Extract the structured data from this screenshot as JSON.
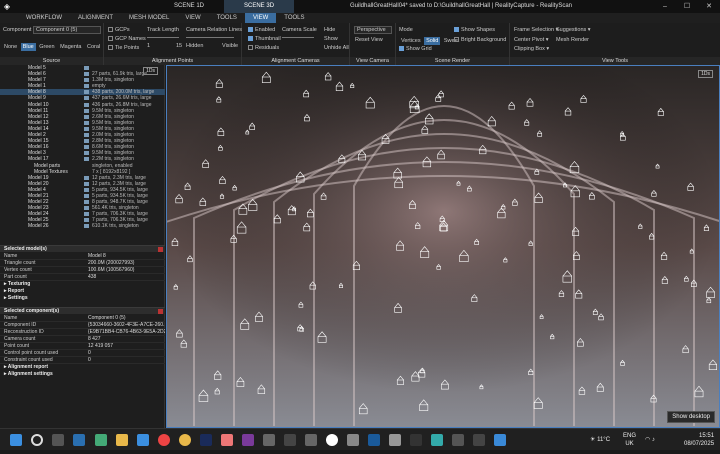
{
  "titlebar": {
    "tab_scene1d": "SCENE 1D",
    "tab_scene3d": "SCENE 3D",
    "title": "GuildhallGreatHall04* saved to D:\\GuildhallGreatHall | RealityCapture - RealityScan",
    "min": "–",
    "max": "☐",
    "close": "✕"
  },
  "menu": {
    "items": [
      "WORKFLOW",
      "ALIGNMENT",
      "MESH MODEL",
      "VIEW",
      "TOOLS",
      "VIEW",
      "TOOLS"
    ],
    "active_index": 5
  },
  "ribbon": {
    "source": {
      "title": "Source",
      "component_label": "Component",
      "component_value": "Component 0 (5)",
      "colors": [
        "None",
        "Blue",
        "Green",
        "Magenta",
        "Coral"
      ],
      "active_color": "Blue"
    },
    "alignment_points": {
      "title": "Alignment Points",
      "gcps": "GCPs",
      "gcp_names": "GCP Names",
      "tie_points": "Tie Points",
      "track_length": "Track Length",
      "track_min": "1",
      "track_max": "15",
      "relation_lines": "Camera Relation Lines",
      "hidden": "Hidden",
      "visible": "Visible"
    },
    "alignment_cameras": {
      "title": "Alignment Cameras",
      "enabled": "Enabled",
      "thumbnail": "Thumbnail",
      "residuals": "Residuals",
      "camera_scale": "Camera Scale",
      "hide": "Hide",
      "show": "Show",
      "unhide_all": "Unhide All"
    },
    "view_camera": {
      "title": "View Camera",
      "projection": "Perspective",
      "reset_view": "Reset View"
    },
    "scene_render": {
      "title": "Scene Render",
      "mode": "Mode",
      "vertices": "Vertices",
      "solid": "Solid",
      "sweet": "Sweet",
      "show_grid": "Show Grid",
      "show_shapes": "Show Shapes",
      "bright_background": "Bright Background"
    },
    "view_tools": {
      "title": "View Tools",
      "frame_selection": "Frame Selection",
      "suggestions": "Suggestions",
      "center_pivot": "Center Pivot",
      "mesh_render": "Mesh Render",
      "clipping_box": "Clipping Box"
    }
  },
  "tree": {
    "badge": "1Ds",
    "rows": [
      {
        "label": "Model 5",
        "info": "",
        "sub": false
      },
      {
        "label": "Model 6",
        "info": "27 parts, 61.9k tris, large",
        "sub": false
      },
      {
        "label": "Model 7",
        "info": "1.3M tris, singleton",
        "sub": false
      },
      {
        "label": "Model 1",
        "info": "empty",
        "sub": false
      },
      {
        "label": "Model 8",
        "info": "438 parts, 200.0M tris, large",
        "sub": false
      },
      {
        "label": "Model 9",
        "info": "437 parts, 26.6M tris, large",
        "sub": false
      },
      {
        "label": "Model 10",
        "info": "436 parts, 26.8M tris, large",
        "sub": false
      },
      {
        "label": "Model 11",
        "info": "9.5M tris, singleton",
        "sub": false
      },
      {
        "label": "Model 12",
        "info": "2.6M tris, singleton",
        "sub": false
      },
      {
        "label": "Model 13",
        "info": "9.5M tris, singleton",
        "sub": false
      },
      {
        "label": "Model 14",
        "info": "9.5M tris, singleton",
        "sub": false
      },
      {
        "label": "Model 2",
        "info": "2.0M tris, singleton",
        "sub": false
      },
      {
        "label": "Model 15",
        "info": "2.8M tris, singleton",
        "sub": false
      },
      {
        "label": "Model 16",
        "info": "8.6M tris, singleton",
        "sub": false
      },
      {
        "label": "Model 3",
        "info": "9.5M tris, singleton",
        "sub": false
      },
      {
        "label": "Model 17",
        "info": "2.2M tris, singleton",
        "sub": false
      },
      {
        "label": "Model parts",
        "info": "singleton, enabled",
        "sub": true
      },
      {
        "label": "Model Textures",
        "info": "7 x [ 8192x8192 ]",
        "sub": true
      },
      {
        "label": "Model 19",
        "info": "12 parts, 2.3M tris, large",
        "sub": false
      },
      {
        "label": "Model 20",
        "info": "12 parts, 2.3M tris, large",
        "sub": false
      },
      {
        "label": "Model 4",
        "info": "5 parts, 934.5K tris, large",
        "sub": false
      },
      {
        "label": "Model 21",
        "info": "5 parts, 934.5K tris, large",
        "sub": false
      },
      {
        "label": "Model 22",
        "info": "8 parts, 948.7K tris, large",
        "sub": false
      },
      {
        "label": "Model 23",
        "info": "561.4K tris, singleton",
        "sub": false
      },
      {
        "label": "Model 24",
        "info": "7 parts, 706.3K tris, large",
        "sub": false
      },
      {
        "label": "Model 25",
        "info": "7 parts, 706.3K tris, large",
        "sub": false
      },
      {
        "label": "Model 26",
        "info": "610.1K tris, singleton",
        "sub": false
      }
    ]
  },
  "selected_model": {
    "title": "Selected model(s)",
    "rows": [
      {
        "k": "Name",
        "v": "Model 8"
      },
      {
        "k": "Triangle count",
        "v": "200.0M (200027993)"
      },
      {
        "k": "Vertex count",
        "v": "100.6M (100567960)"
      },
      {
        "k": "Part count",
        "v": "438"
      }
    ],
    "subs": [
      "Texturing",
      "Report",
      "Settings"
    ]
  },
  "selected_component": {
    "title": "Selected component(s)",
    "rows": [
      {
        "k": "Name",
        "v": "Component 0 (5)"
      },
      {
        "k": "Component ID",
        "v": "{53034660-3602-4F3E-A7CE-260..."
      },
      {
        "k": "Reconstruction ID",
        "v": "{E9B71BB4-CB76-4B63-9E5A-2D2..."
      },
      {
        "k": "Camera count",
        "v": "8 427"
      },
      {
        "k": "Point count",
        "v": "12 419 057"
      },
      {
        "k": "Control point count used",
        "v": "0"
      },
      {
        "k": "Constraint count used",
        "v": "0"
      }
    ],
    "subs": [
      "Alignment report",
      "Alignment settings"
    ]
  },
  "viewport": {
    "badge": "1Ds",
    "show_desktop": "Show desktop"
  },
  "taskbar": {
    "weather": "11°C",
    "lang1": "ENG",
    "lang2": "UK",
    "time": "15:51",
    "date": "08/07/2025"
  }
}
